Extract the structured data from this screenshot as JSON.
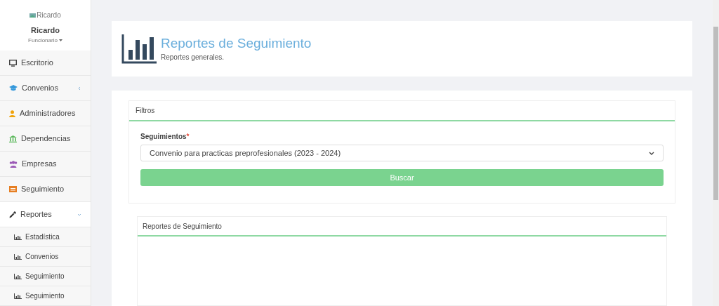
{
  "user": {
    "avatar_alt": "Ricardo",
    "name": "Ricardo",
    "role": "Funcionario"
  },
  "sidebar": {
    "items": [
      {
        "kind": "desktop",
        "label": "Escritorio"
      },
      {
        "kind": "cap",
        "label": "Convenios",
        "expanded": false
      },
      {
        "kind": "user",
        "label": "Administradores"
      },
      {
        "kind": "bank",
        "label": "Dependencias"
      },
      {
        "kind": "users",
        "label": "Empresas"
      },
      {
        "kind": "list",
        "label": "Seguimiento"
      },
      {
        "kind": "dropper",
        "label": "Reportes",
        "expanded": true,
        "children": [
          {
            "label": "Estadística"
          },
          {
            "label": "Convenios"
          },
          {
            "label": "Seguimiento"
          },
          {
            "label": "Seguimiento"
          }
        ]
      }
    ]
  },
  "header": {
    "title": "Reportes de Seguimiento",
    "subtitle": "Reportes generales."
  },
  "filters": {
    "title": "Filtros",
    "field_label": "Seguimientos",
    "required_mark": "*",
    "value": "Convenio para practicas preprofesionales (2023 - 2024)",
    "button": "Buscar"
  },
  "results": {
    "title": "Reportes de Seguimiento"
  }
}
